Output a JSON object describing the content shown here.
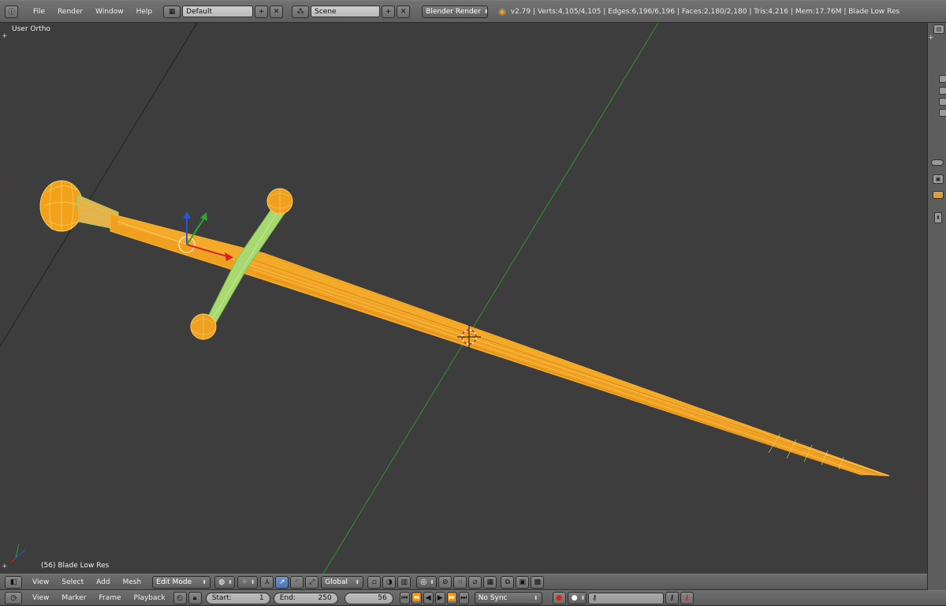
{
  "topbar": {
    "menus": [
      "File",
      "Render",
      "Window",
      "Help"
    ],
    "layout": "Default",
    "scene": "Scene",
    "engine": "Blender Render",
    "stats": "v2.79 | Verts:4,105/4,105 | Edges:6,196/6,196 | Faces:2,180/2,180 | Tris:4,216 | Mem:17.76M | Blade Low Res"
  },
  "viewport": {
    "view_label": "User Ortho",
    "object_label": "(56) Blade Low Res"
  },
  "view_header": {
    "menus": [
      "View",
      "Select",
      "Add",
      "Mesh"
    ],
    "mode": "Edit Mode",
    "orientation": "Global"
  },
  "timeline": {
    "menus": [
      "View",
      "Marker",
      "Frame",
      "Playback"
    ],
    "start_label": "Start:",
    "start_value": "1",
    "end_label": "End:",
    "end_value": "250",
    "current_frame": "56",
    "sync": "No Sync"
  },
  "colors": {
    "background": "#3d3d3d",
    "blade_orange": "#f0a020",
    "guard_green": "#8fd05a",
    "axis_red": "#d92020",
    "axis_green": "#2aa82a",
    "axis_blue": "#2b55d6"
  }
}
